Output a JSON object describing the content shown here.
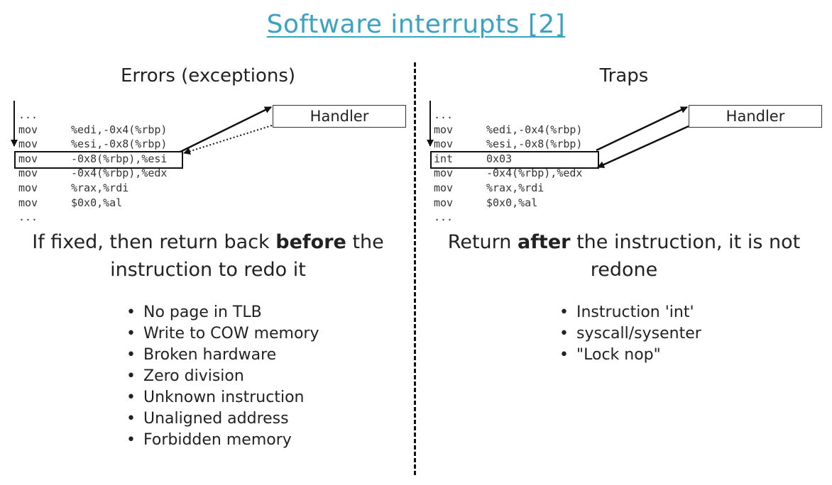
{
  "title": "Software interrupts [2]",
  "left": {
    "heading": "Errors (exceptions)",
    "code": [
      {
        "op": "...",
        "args": ""
      },
      {
        "op": "mov",
        "args": "%edi,-0x4(%rbp)"
      },
      {
        "op": "mov",
        "args": "%esi,-0x8(%rbp)"
      },
      {
        "op": "mov",
        "args": "-0x8(%rbp),%esi"
      },
      {
        "op": "mov",
        "args": "-0x4(%rbp),%edx"
      },
      {
        "op": "mov",
        "args": "%rax,%rdi"
      },
      {
        "op": "mov",
        "args": "$0x0,%al"
      },
      {
        "op": "...",
        "args": ""
      }
    ],
    "handler": "Handler",
    "desc_pre": "If fixed, then return back ",
    "desc_bold": "before",
    "desc_post": " the instruction to redo it",
    "bullets": [
      "No page in TLB",
      "Write to COW memory",
      "Broken hardware",
      "Zero division",
      "Unknown instruction",
      "Unaligned address",
      "Forbidden memory"
    ]
  },
  "right": {
    "heading": "Traps",
    "code": [
      {
        "op": "...",
        "args": ""
      },
      {
        "op": "mov",
        "args": "%edi,-0x4(%rbp)"
      },
      {
        "op": "mov",
        "args": "%esi,-0x8(%rbp)"
      },
      {
        "op": "int",
        "args": "0x03"
      },
      {
        "op": "mov",
        "args": "-0x4(%rbp),%edx"
      },
      {
        "op": "mov",
        "args": "%rax,%rdi"
      },
      {
        "op": "mov",
        "args": "$0x0,%al"
      },
      {
        "op": "...",
        "args": ""
      }
    ],
    "handler": "Handler",
    "desc_pre": "Return ",
    "desc_bold": "after",
    "desc_post": " the instruction, it is not redone",
    "bullets": [
      "Instruction 'int'",
      "syscall/sysenter",
      "\"Lock nop\""
    ]
  }
}
